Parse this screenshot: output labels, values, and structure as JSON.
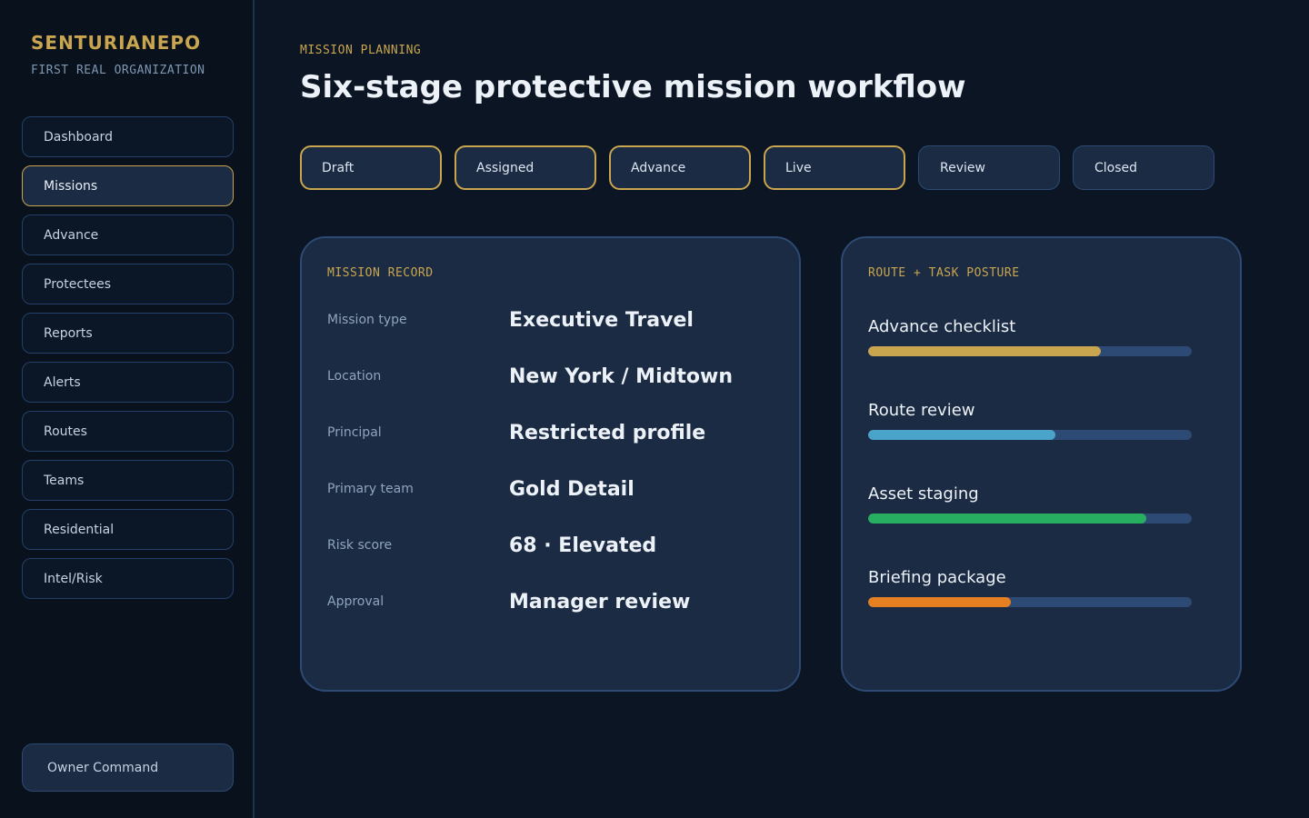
{
  "brand": {
    "name": "SENTURIANEPO",
    "subtitle": "FIRST REAL ORGANIZATION"
  },
  "sidebar": {
    "items": [
      {
        "label": "Dashboard",
        "active": false
      },
      {
        "label": "Missions",
        "active": true
      },
      {
        "label": "Advance",
        "active": false
      },
      {
        "label": "Protectees",
        "active": false
      },
      {
        "label": "Reports",
        "active": false
      },
      {
        "label": "Alerts",
        "active": false
      },
      {
        "label": "Routes",
        "active": false
      },
      {
        "label": "Teams",
        "active": false
      },
      {
        "label": "Residential",
        "active": false
      },
      {
        "label": "Intel/Risk",
        "active": false
      }
    ],
    "footer_label": "Owner Command"
  },
  "header": {
    "eyebrow": "MISSION PLANNING",
    "title": "Six-stage protective mission workflow"
  },
  "stages": [
    {
      "label": "Draft",
      "complete": true
    },
    {
      "label": "Assigned",
      "complete": true
    },
    {
      "label": "Advance",
      "complete": true
    },
    {
      "label": "Live",
      "complete": true
    },
    {
      "label": "Review",
      "complete": false
    },
    {
      "label": "Closed",
      "complete": false
    }
  ],
  "mission_record": {
    "label": "MISSION RECORD",
    "rows": [
      {
        "key": "Mission type",
        "value": "Executive Travel"
      },
      {
        "key": "Location",
        "value": "New York / Midtown"
      },
      {
        "key": "Principal",
        "value": "Restricted profile"
      },
      {
        "key": "Primary team",
        "value": "Gold Detail"
      },
      {
        "key": "Risk score",
        "value": "68 · Elevated"
      },
      {
        "key": "Approval",
        "value": "Manager review"
      }
    ]
  },
  "route_posture": {
    "label": "ROUTE + TASK POSTURE",
    "tasks": [
      {
        "label": "Advance checklist",
        "progress": 0.72,
        "color": "#c9a54f"
      },
      {
        "label": "Route review",
        "progress": 0.58,
        "color": "#4aa3c9"
      },
      {
        "label": "Asset staging",
        "progress": 0.86,
        "color": "#27ae60"
      },
      {
        "label": "Briefing package",
        "progress": 0.44,
        "color": "#e67e22"
      }
    ]
  },
  "colors": {
    "accent": "#c9a54f",
    "background": "#0b1523",
    "panel": "#1b2b43",
    "border": "#2c4a73"
  }
}
